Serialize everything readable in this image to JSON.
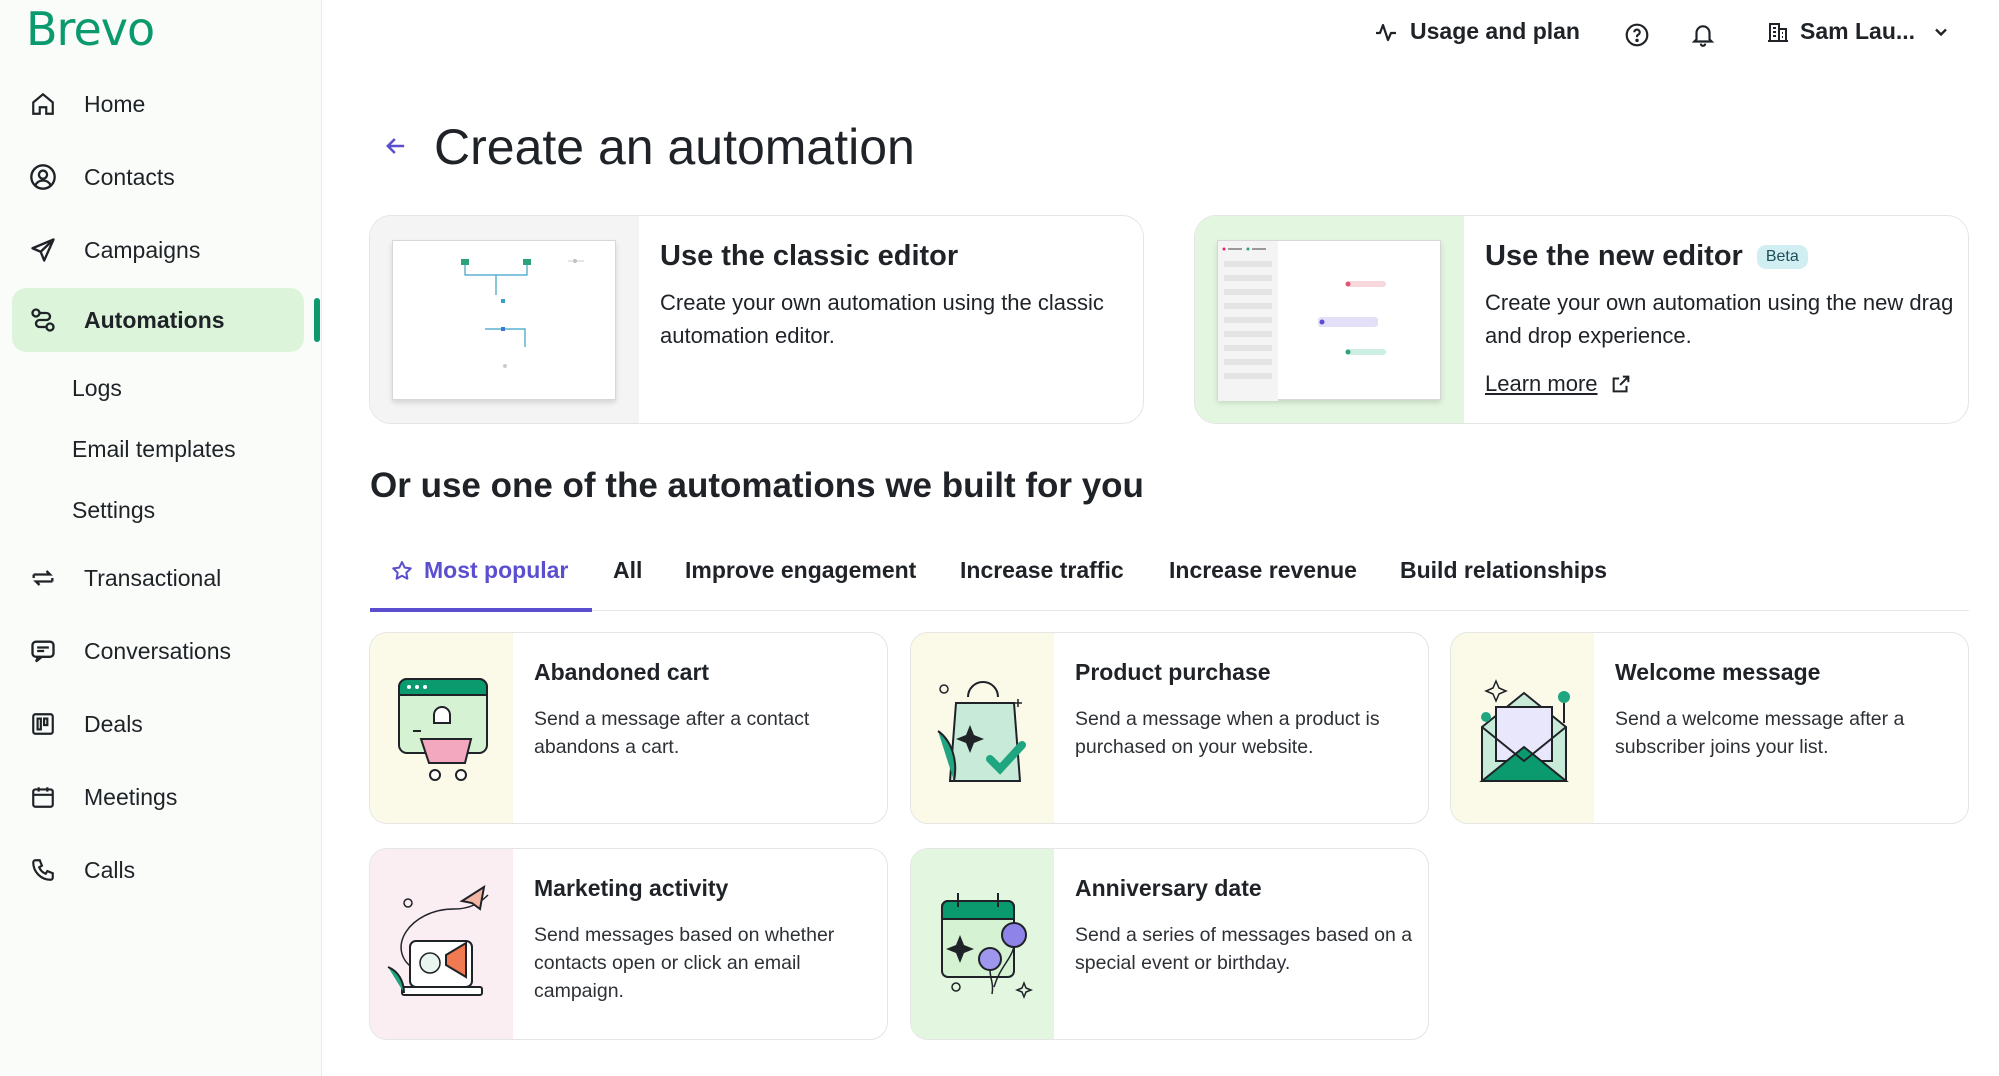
{
  "brand": {
    "logo_text": "Brevo",
    "accent": "#0b996e",
    "purple": "#5b4fd0"
  },
  "sidebar": {
    "items": [
      {
        "label": "Home",
        "icon": "home-icon"
      },
      {
        "label": "Contacts",
        "icon": "contacts-icon"
      },
      {
        "label": "Campaigns",
        "icon": "send-icon"
      },
      {
        "label": "Automations",
        "icon": "automation-icon",
        "active": true
      },
      {
        "label": "Transactional",
        "icon": "transactional-icon"
      },
      {
        "label": "Conversations",
        "icon": "chat-icon"
      },
      {
        "label": "Deals",
        "icon": "deals-icon"
      },
      {
        "label": "Meetings",
        "icon": "calendar-icon"
      },
      {
        "label": "Calls",
        "icon": "phone-icon"
      }
    ],
    "subitems": [
      "Logs",
      "Email templates",
      "Settings"
    ]
  },
  "header": {
    "usage_label": "Usage and plan",
    "account_name": "Sam Lau..."
  },
  "page": {
    "title": "Create an automation",
    "classic": {
      "title": "Use the classic editor",
      "desc": "Create your own automation using the classic automation editor."
    },
    "new_editor": {
      "title": "Use the new editor",
      "badge": "Beta",
      "desc": "Create your own automation using the new drag and drop experience.",
      "link": "Learn more"
    },
    "section_title": "Or use one of the automations we built for you",
    "tabs": [
      "Most popular",
      "All",
      "Improve engagement",
      "Increase traffic",
      "Increase revenue",
      "Build relationships"
    ],
    "cards": [
      {
        "title": "Abandoned cart",
        "desc": "Send a message after a contact abandons a cart."
      },
      {
        "title": "Product purchase",
        "desc": "Send a message when a product is purchased on your website."
      },
      {
        "title": "Welcome message",
        "desc": "Send a welcome message after a subscriber joins your list."
      },
      {
        "title": "Marketing activity",
        "desc": "Send messages based on whether contacts open or click an email campaign."
      },
      {
        "title": "Anniversary date",
        "desc": "Send a series of messages based on a special event or birthday."
      }
    ]
  }
}
